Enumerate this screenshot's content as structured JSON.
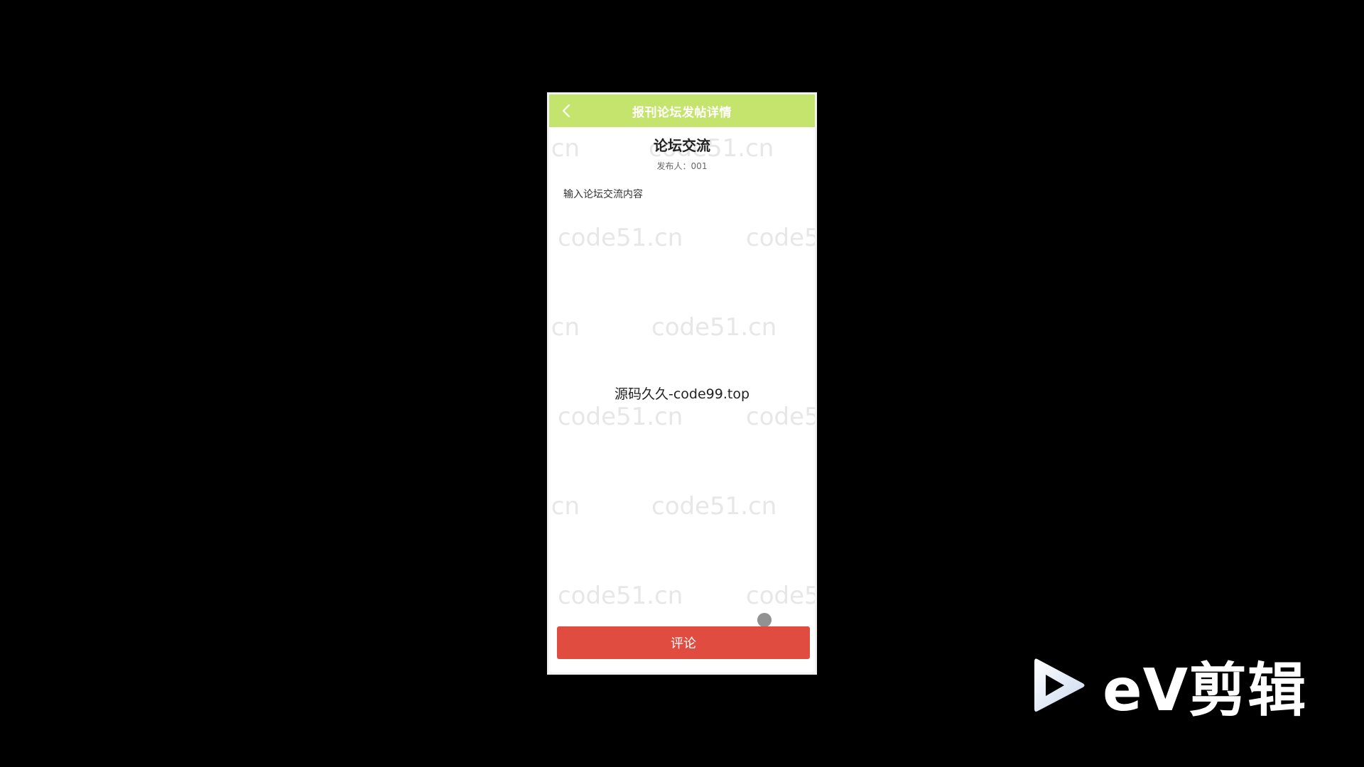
{
  "header": {
    "title": "报刊论坛发帖详情",
    "back_icon": "chevron-left-icon"
  },
  "post": {
    "title": "论坛交流",
    "author": "发布人：001",
    "content": "输入论坛交流内容"
  },
  "overlay": {
    "center_text": "源码久久-code99.top"
  },
  "watermark": {
    "text": "code51.cn",
    "partial_left": ".cn",
    "partial_right": "code5"
  },
  "comment_button": {
    "label": "评论"
  },
  "logo": {
    "text": "eV剪辑"
  },
  "colors": {
    "header_bg": "#c5e46e",
    "button_bg": "#e14c40",
    "page_bg": "#000000"
  }
}
